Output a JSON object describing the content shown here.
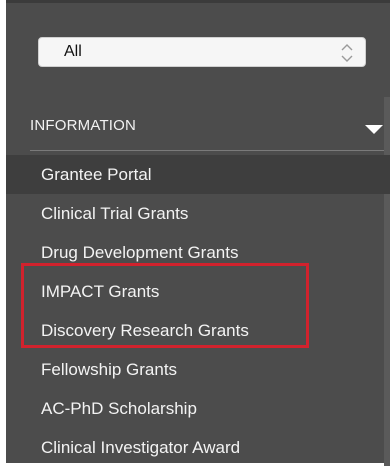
{
  "filter": {
    "selected_value": "All"
  },
  "section": {
    "title": "INFORMATION"
  },
  "nav": {
    "items": [
      {
        "label": "Grantee Portal",
        "active": true
      },
      {
        "label": "Clinical Trial Grants"
      },
      {
        "label": "Drug Development Grants"
      },
      {
        "label": "IMPACT Grants",
        "highlighted": true
      },
      {
        "label": "Discovery Research Grants",
        "highlighted": true
      },
      {
        "label": "Fellowship Grants"
      },
      {
        "label": "AC-PhD Scholarship"
      },
      {
        "label": "Clinical Investigator Award"
      }
    ]
  },
  "colors": {
    "panel_bg": "#4c4c4c",
    "active_row": "#3e3e3e",
    "highlight_border": "#d1222d",
    "text": "#f3f3f3"
  },
  "icons": {
    "filter_arrows": "chevron-up-down-icon",
    "section_toggle": "triangle-down-icon"
  }
}
